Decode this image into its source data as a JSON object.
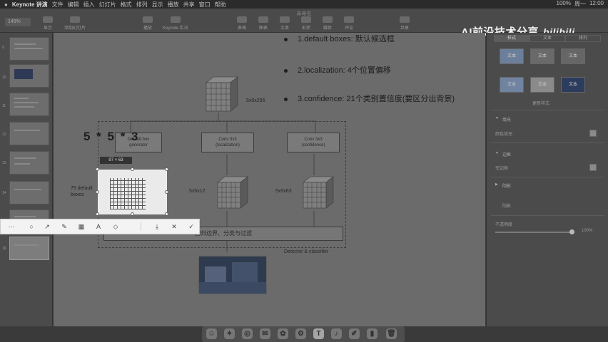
{
  "menubar": {
    "app": "Keynote 讲演",
    "items": [
      "文件",
      "编辑",
      "插入",
      "幻灯片",
      "格式",
      "排列",
      "显示",
      "播放",
      "共享",
      "窗口",
      "帮助"
    ],
    "right": [
      "100%",
      "周一",
      "12:00"
    ]
  },
  "toolbar": {
    "document_title": "未命名",
    "zoom": "149%",
    "buttons": [
      "显示",
      "缩放",
      "添加幻灯片",
      "播放",
      "Keynote 实况",
      "表格",
      "图表",
      "文本",
      "形状",
      "媒体",
      "评论",
      "共享",
      "格式",
      "动画效果",
      "文稿"
    ]
  },
  "watermark": {
    "text": "AI前沿技术分享",
    "logo": "bilibili"
  },
  "navigator": {
    "slide_numbers": [
      "9",
      "10",
      "11",
      "12",
      "13",
      "14",
      "15",
      "16"
    ]
  },
  "slide": {
    "bullets": [
      "1.default boxes: 默认候选框",
      "2.localization:  4个位置偏移",
      "3.confidence:  21个类别置信度(要区分出背景)"
    ],
    "overlay_formula": "5 * 5 * 3",
    "feature_size_top": "5x5x256",
    "boxes": {
      "default_box_generator": [
        "Default box",
        "generator"
      ],
      "conv_localization": [
        "Conv 3x3",
        "(localization)"
      ],
      "conv_confidence": [
        "Conv 3x3",
        "(confidence)"
      ]
    },
    "label_75_default": [
      "75 default",
      "boxes"
    ],
    "label_5x5x12": "5x5x12",
    "label_5x5x63": "5x5x63",
    "bar_text": "回归边界、分类与过滤",
    "detector_label": "Detector & classifier"
  },
  "capture": {
    "size_badge": "97 × 63"
  },
  "annotation_toolbar": {
    "icons": [
      "dots-icon",
      "circle-icon",
      "arrow-icon",
      "pen-icon",
      "mosaic-icon",
      "text-icon",
      "eraser-icon",
      "download-icon",
      "close-icon",
      "check-icon"
    ],
    "glyphs": [
      "⋯",
      "○",
      "↗",
      "✎",
      "▦",
      "A",
      "◇",
      "⤓",
      "✕",
      "✓"
    ]
  },
  "inspector": {
    "tabs": [
      "样式",
      "文本",
      "排列"
    ],
    "style_buttons": [
      "文本",
      "文本",
      "文本",
      "文本",
      "文本",
      "文本"
    ],
    "update_style": "更新样式",
    "fill_title": "填充",
    "fill_value": "颜色填充",
    "border_title": "边框",
    "border_value": "无边框",
    "shadow_title": "阴影",
    "shadow_value": "阴影",
    "opacity_title": "不透明度",
    "opacity_value": "100%"
  },
  "dock": {
    "apps": [
      "finder-icon",
      "launchpad-icon",
      "safari-icon",
      "mail-icon",
      "photos-icon",
      "settings-icon",
      "keynote-icon",
      "music-icon",
      "notes-icon",
      "terminal-icon",
      "trash-icon"
    ],
    "glyphs": [
      "☺",
      "✦",
      "◎",
      "✉",
      "✿",
      "⚙",
      "T",
      "♪",
      "✐",
      "▮",
      "🗑"
    ]
  }
}
